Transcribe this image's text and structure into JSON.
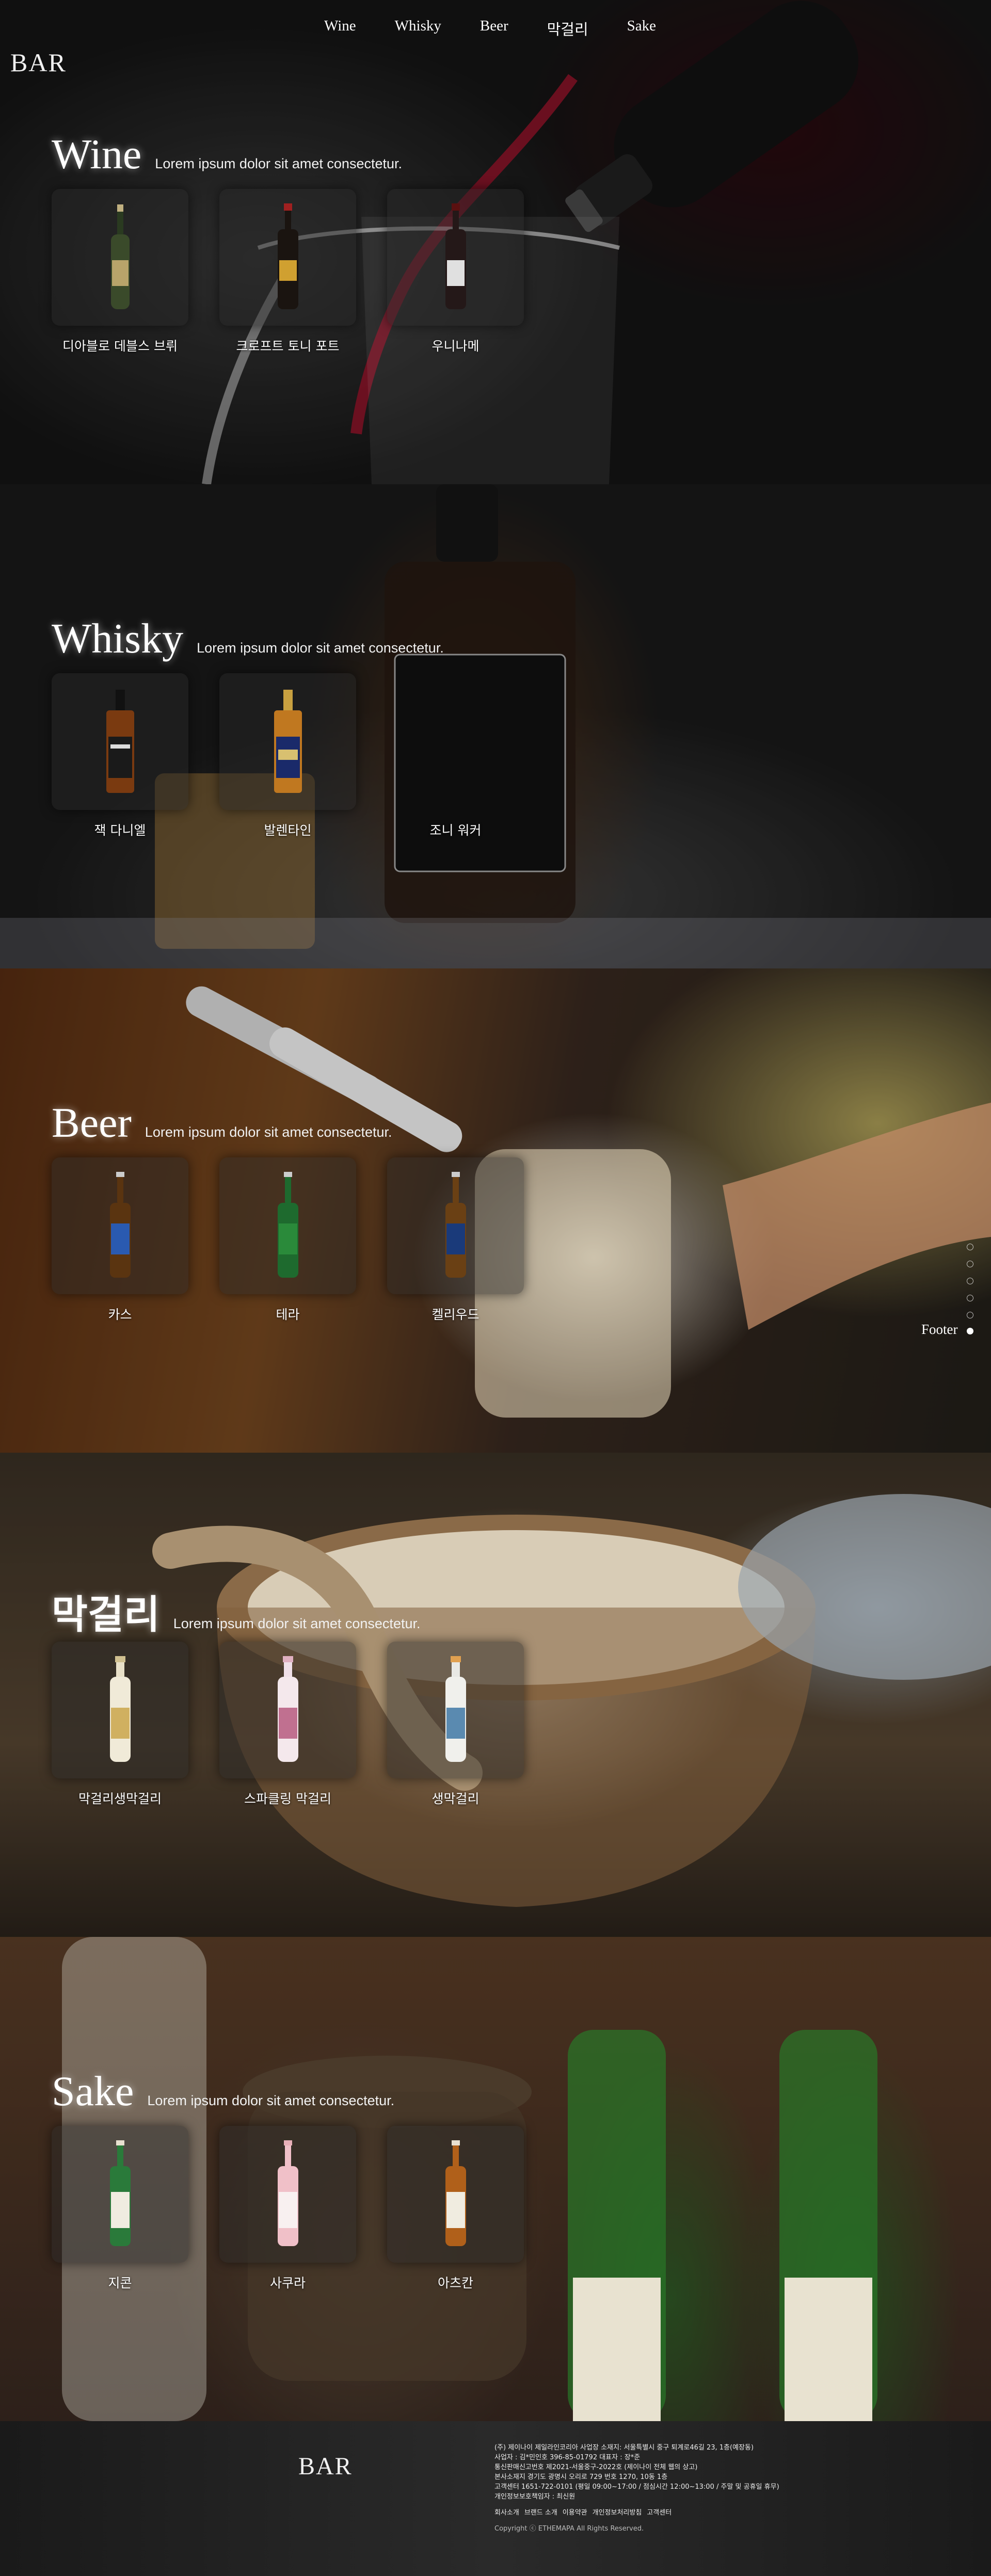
{
  "logo": "BAR",
  "nav": [
    "Wine",
    "Whisky",
    "Beer",
    "막걸리",
    "Sake"
  ],
  "sections": [
    {
      "title": "Wine",
      "desc": "Lorem ipsum dolor sit amet consectetur.",
      "items": [
        {
          "name": "디아블로 데블스 브뤼",
          "icon": "green-wine-bottle-icon",
          "color": "#3a4a2a",
          "label": "#b8a46a"
        },
        {
          "name": "크로프트 토니 포트",
          "icon": "dark-port-bottle-icon",
          "color": "#1a1410",
          "label": "#d0a030"
        },
        {
          "name": "우니나메",
          "icon": "red-wine-bottle-icon",
          "color": "#241818",
          "label": "#e0e0e0"
        }
      ]
    },
    {
      "title": "Whisky",
      "desc": "Lorem ipsum dolor sit amet consectetur.",
      "items": [
        {
          "name": "잭 다니엘",
          "icon": "jack-daniels-bottle-icon",
          "color": "#7a3a10",
          "label": "#1a1a1a"
        },
        {
          "name": "발렌타인",
          "icon": "ballantines-bottle-icon",
          "color": "#c07820",
          "label": "#1a2a6a"
        },
        {
          "name": "조니 워커",
          "icon": "",
          "color": "",
          "label": ""
        }
      ]
    },
    {
      "title": "Beer",
      "desc": "Lorem ipsum dolor sit amet consectetur.",
      "items": [
        {
          "name": "카스",
          "icon": "cass-beer-bottle-icon",
          "color": "#5a3410",
          "label": "#2a5ab0"
        },
        {
          "name": "테라",
          "icon": "terra-beer-bottle-icon",
          "color": "#1e6a2e",
          "label": "#2a8a3a"
        },
        {
          "name": "켈리우드",
          "icon": "kelly-beer-bottle-icon",
          "color": "#6a4014",
          "label": "#1a3a7a"
        }
      ]
    },
    {
      "title": "막걸리",
      "desc": "Lorem ipsum dolor sit amet consectetur.",
      "items": [
        {
          "name": "막걸리생막걸리",
          "icon": "makgeolli-bottle-icon",
          "color": "#f0ead8",
          "label": "#d0b060"
        },
        {
          "name": "스파클링 막걸리",
          "icon": "sparkling-makgeolli-bottle-icon",
          "color": "#f4e8ec",
          "label": "#c07090"
        },
        {
          "name": "생막걸리",
          "icon": "fresh-makgeolli-bottle-icon",
          "color": "#f0f0ec",
          "label": "#5a8ab0"
        }
      ]
    },
    {
      "title": "Sake",
      "desc": "Lorem ipsum dolor sit amet consectetur.",
      "items": [
        {
          "name": "지콘",
          "icon": "green-sake-bottle-icon",
          "color": "#2a7a3a",
          "label": "#f0ece0"
        },
        {
          "name": "사쿠라",
          "icon": "pink-sake-bottle-icon",
          "color": "#f0c0c8",
          "label": "#f8f0f0"
        },
        {
          "name": "아츠칸",
          "icon": "amber-sake-bottle-icon",
          "color": "#b0601a",
          "label": "#f0ece0"
        }
      ]
    }
  ],
  "side_nav": {
    "label": "Footer"
  },
  "footer": {
    "logo": "BAR",
    "info": [
      "(주) 제이나이 제일라인코리아 사업장 소재지: 서울특별시 중구 퇴계로46길 23, 1층(예장동)",
      "사업자 : 김*민인호  396-85-01792    대표자 : 장*준",
      "통신판매신고번호 제2021-서울중구-2022호 (제이나이 전체 웹의 상고)",
      "본사소재지 경기도 광명시 오리로 729 번호 1270, 10동 1층",
      "고객센터 1651-722-0101 (평일 09:00~17:00 / 점심시간 12:00~13:00 / 주말 및 공휴일 휴무)",
      "개인정보보호책임자 : 최신원"
    ],
    "links": [
      "회사소개",
      "브랜드 소개",
      "이용약관",
      "개인정보처리방침",
      "고객센터"
    ],
    "copyright": "Copyright ⓒ ETHEMAPA All Rights Reserved."
  }
}
